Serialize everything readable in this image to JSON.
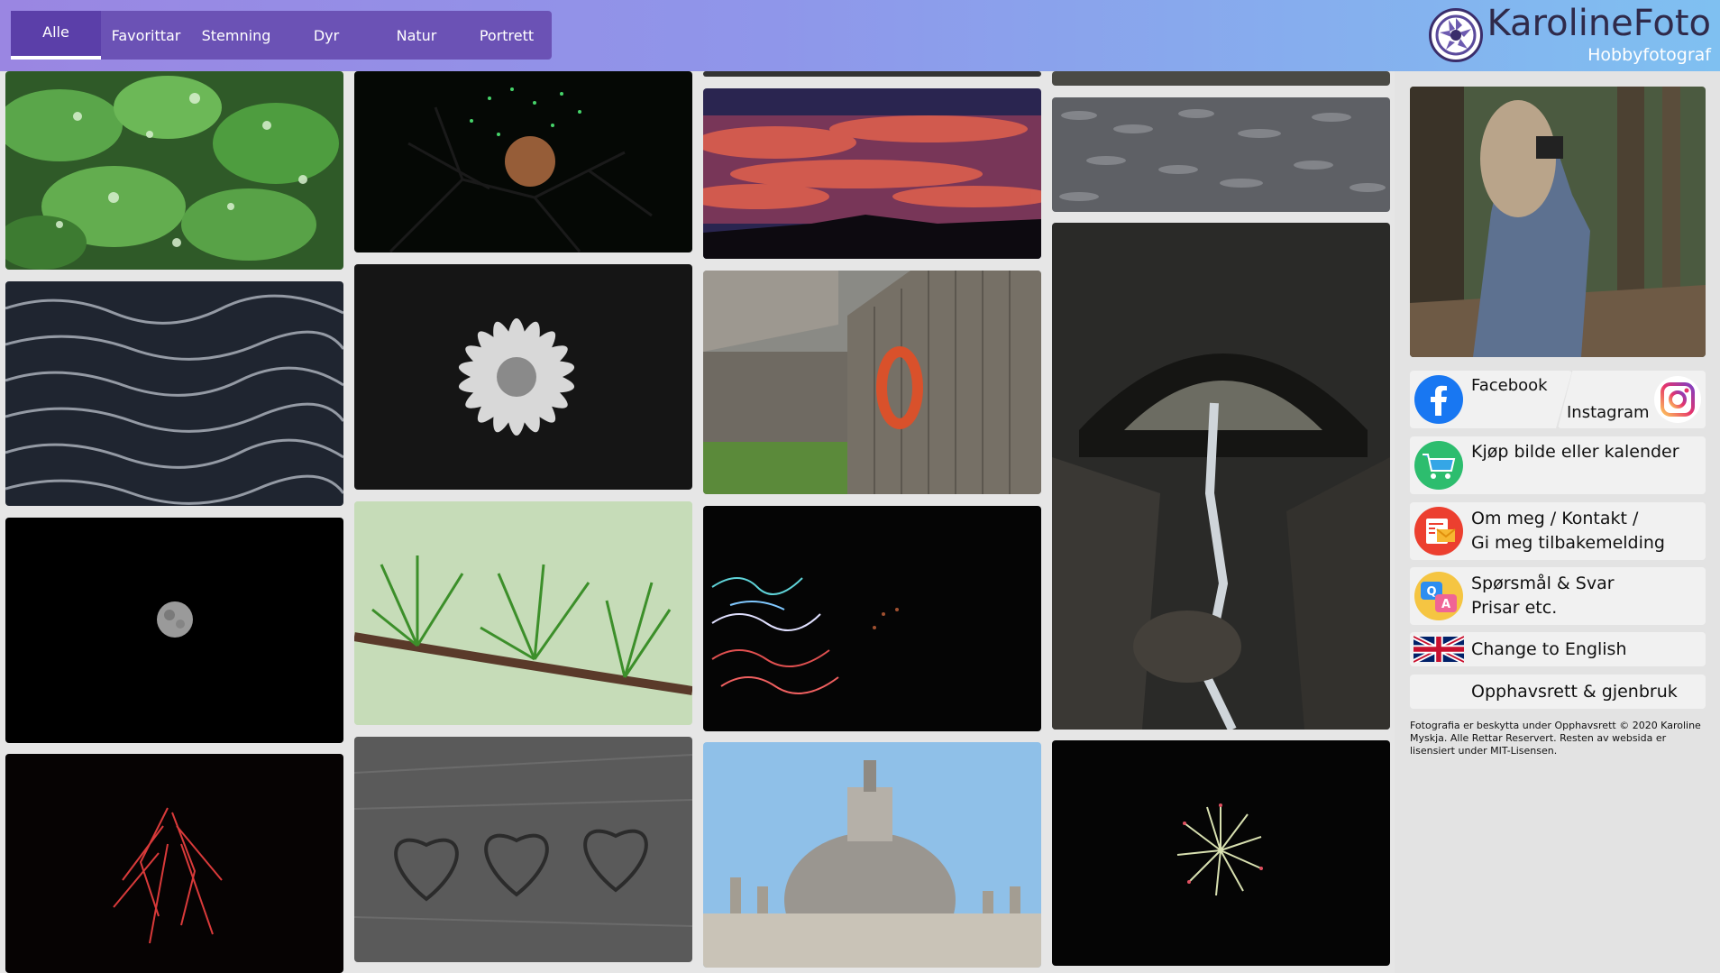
{
  "nav": {
    "items": [
      {
        "label": "Alle",
        "active": true
      },
      {
        "label": "Favorittar",
        "active": false
      },
      {
        "label": "Stemning",
        "active": false
      },
      {
        "label": "Dyr",
        "active": false
      },
      {
        "label": "Natur",
        "active": false
      },
      {
        "label": "Portrett",
        "active": false
      }
    ]
  },
  "brand": {
    "title": "KarolineFoto",
    "subtitle": "Hobbyfotograf"
  },
  "gallery": {
    "photos": [
      {
        "subject": "green clover leaves with water droplets"
      },
      {
        "subject": "fireworks through tree branches"
      },
      {
        "subject": "red sunset clouds over hills"
      },
      {
        "subject": "grey water surface"
      },
      {
        "subject": "dark rippling water"
      },
      {
        "subject": "white daisy in black and white"
      },
      {
        "subject": "old wooden barn with orange lifebuoy"
      },
      {
        "subject": "waterfall under stone bridge"
      },
      {
        "subject": "full moon in black sky"
      },
      {
        "subject": "green larch branch with raindrops"
      },
      {
        "subject": "colored light trails at night"
      },
      {
        "subject": "red fireworks"
      },
      {
        "subject": "hearts drawn in sand"
      },
      {
        "subject": "St. Peter's Basilica dome"
      },
      {
        "subject": "firework burst"
      }
    ]
  },
  "sidebar": {
    "facebook_label": "Facebook",
    "instagram_label": "Instagram",
    "buy_label": "Kjøp bilde eller kalender",
    "about_line1": "Om meg / Kontakt /",
    "about_line2": "Gi meg tilbakemelding",
    "faq_line1": "Spørsmål & Svar",
    "faq_line2": "Prisar etc.",
    "english_label": "Change to English",
    "copyright_label": "Opphavsrett & gjenbruk",
    "footer": "Fotografia er beskytta under Opphavsrett © 2020 Karoline Myskja. Alle Rettar Reservert. Resten av websida er lisensiert under MIT-Lisensen."
  },
  "colors": {
    "header_start": "#9a86e2",
    "header_end": "#7fc0f1",
    "nav_bg": "#6b52b5",
    "nav_active": "#5b3fa9"
  }
}
